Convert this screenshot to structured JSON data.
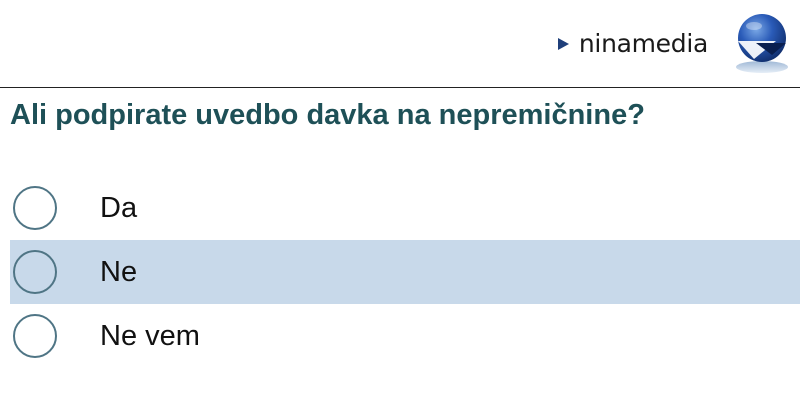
{
  "header": {
    "brand_name": "ninamedia",
    "logo_icon": "ninamedia-globe-logo-icon",
    "accent_color": "#1f3f7a"
  },
  "question": {
    "text": "Ali podpirate uvedbo davka na nepremičnine?",
    "color": "#1e5057"
  },
  "options": [
    {
      "label": "Da",
      "highlighted": false
    },
    {
      "label": "Ne",
      "highlighted": true
    },
    {
      "label": "Ne vem",
      "highlighted": false
    }
  ],
  "highlight_color": "#c8d9ea"
}
